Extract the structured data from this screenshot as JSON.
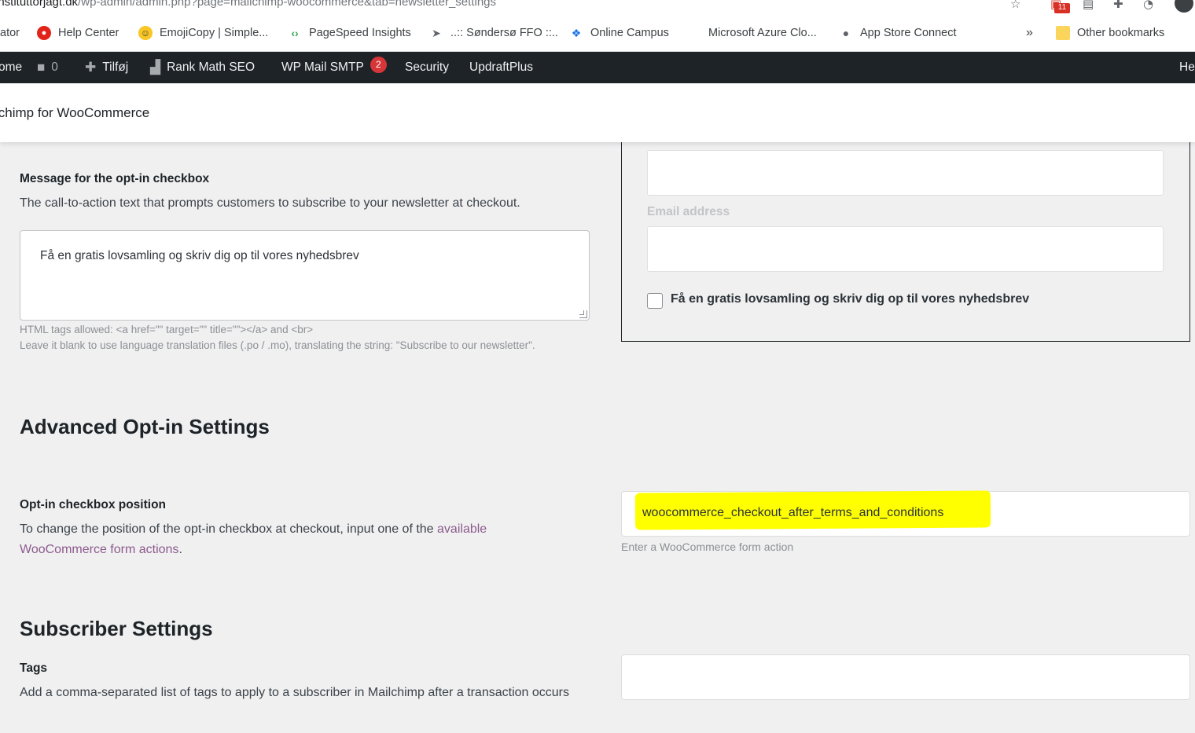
{
  "browser": {
    "url_host": "instituttorjagt.dk",
    "url_path": "/wp-admin/admin.php?page=mailchimp-woocommerce&tab=newsletter_settings",
    "ext_badge": "11",
    "bookmarks": [
      {
        "label": "ator",
        "icon": ""
      },
      {
        "label": "Help Center",
        "icon": "help-center-icon"
      },
      {
        "label": "EmojiCopy | Simple...",
        "icon": "emoji-icon"
      },
      {
        "label": "PageSpeed Insights",
        "icon": "pagespeed-icon"
      },
      {
        "label": "..:: Søndersø FFO ::..",
        "icon": "paper-plane-icon"
      },
      {
        "label": "Online Campus",
        "icon": "campus-icon"
      },
      {
        "label": "Microsoft Azure Clo...",
        "icon": "microsoft-icon"
      },
      {
        "label": "App Store Connect",
        "icon": "apple-icon"
      }
    ],
    "overflow": "»",
    "other_bookmarks": "Other bookmarks"
  },
  "adminbar": {
    "home": "ome",
    "comments_count": "0",
    "add_new": "Tilføj",
    "rank_math": "Rank Math SEO",
    "wp_mail": "WP Mail SMTP",
    "wp_mail_badge": "2",
    "security": "Security",
    "updraft": "UpdraftPlus",
    "howdy": "He"
  },
  "plugin": {
    "title": "lchimp for WooCommerce"
  },
  "optin_message": {
    "label": "Message for the opt-in checkbox",
    "description": "The call-to-action text that prompts customers to subscribe to your newsletter at checkout.",
    "value": "Få en gratis lovsamling og skriv dig op til vores nyhedsbrev",
    "help1": "HTML tags allowed: <a href=\"\" target=\"\" title=\"\"></a> and <br>",
    "help2": "Leave it blank to use language translation files (.po / .mo), translating the string: \"Subscribe to our newsletter\"."
  },
  "preview": {
    "email_label": "Email address",
    "checkbox_label": "Få en gratis lovsamling og skriv dig op til vores nyhedsbrev"
  },
  "advanced": {
    "heading": "Advanced Opt-in Settings",
    "position_label": "Opt-in checkbox position",
    "position_desc": "To change the position of the opt-in checkbox at checkout, input one of the",
    "position_link": "available WooCommerce form actions",
    "position_value": "woocommerce_checkout_after_terms_and_conditions",
    "position_help": "Enter a WooCommerce form action",
    "highlight_color": "#ffff00"
  },
  "subscriber": {
    "heading": "Subscriber Settings",
    "tags_label": "Tags",
    "tags_desc": "Add a comma-separated list of tags to apply to a subscriber in Mailchimp after a transaction occurs",
    "tags_value": ""
  }
}
